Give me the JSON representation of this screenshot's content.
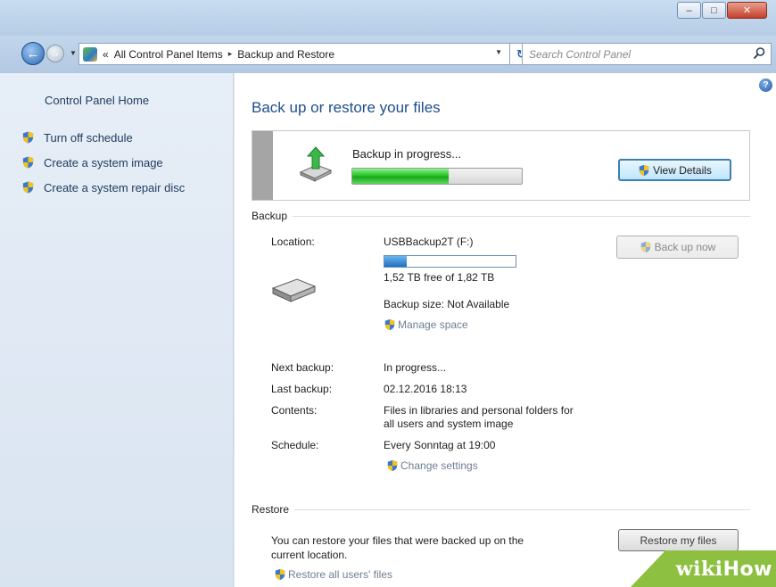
{
  "window": {
    "minimize_glyph": "–",
    "maximize_glyph": "□",
    "close_glyph": "✕"
  },
  "nav": {
    "back_glyph": "←",
    "forward_glyph": "→",
    "breadcrumb_prefix": "«",
    "breadcrumbs": [
      "All Control Panel Items",
      "Backup and Restore"
    ],
    "crumb_separator": "▸",
    "dropdown_glyph": "▼",
    "refresh_glyph": "↻",
    "search_placeholder": "Search Control Panel"
  },
  "sidebar": {
    "home": "Control Panel Home",
    "items": [
      {
        "label": "Turn off schedule",
        "icon": "shield-icon"
      },
      {
        "label": "Create a system image",
        "icon": "shield-icon"
      },
      {
        "label": "Create a system repair disc",
        "icon": "shield-icon"
      }
    ]
  },
  "main": {
    "help_glyph": "?",
    "title": "Back up or restore your files",
    "status": {
      "text": "Backup in progress...",
      "progress_fraction": 0.57,
      "view_details": "View Details"
    },
    "backup": {
      "header": "Backup",
      "location_label": "Location:",
      "location_value": "USBBackup2T (F:)",
      "usage_fraction": 0.17,
      "free_text": "1,52 TB free of 1,82 TB",
      "backup_now": "Back up now",
      "size_text": "Backup size: Not Available",
      "manage_space": "Manage space",
      "next_label": "Next backup:",
      "next_value": "In progress...",
      "last_label": "Last backup:",
      "last_value": "02.12.2016 18:13",
      "contents_label": "Contents:",
      "contents_value_1": "Files in libraries and personal folders for",
      "contents_value_2": "all users and system image",
      "schedule_label": "Schedule:",
      "schedule_value": "Every Sonntag at 19:00",
      "change_settings": "Change settings"
    },
    "restore": {
      "header": "Restore",
      "text_1": "You can restore your files that were backed up on the",
      "text_2": "current location.",
      "restore_my_files": "Restore my files",
      "restore_all": "Restore all users' files"
    }
  },
  "watermark": {
    "wiki": "wiki",
    "how": "How"
  },
  "colors": {
    "title_blue": "#1e4e8c",
    "progress_green": "#28c428",
    "watermark_green": "#8dc040"
  }
}
